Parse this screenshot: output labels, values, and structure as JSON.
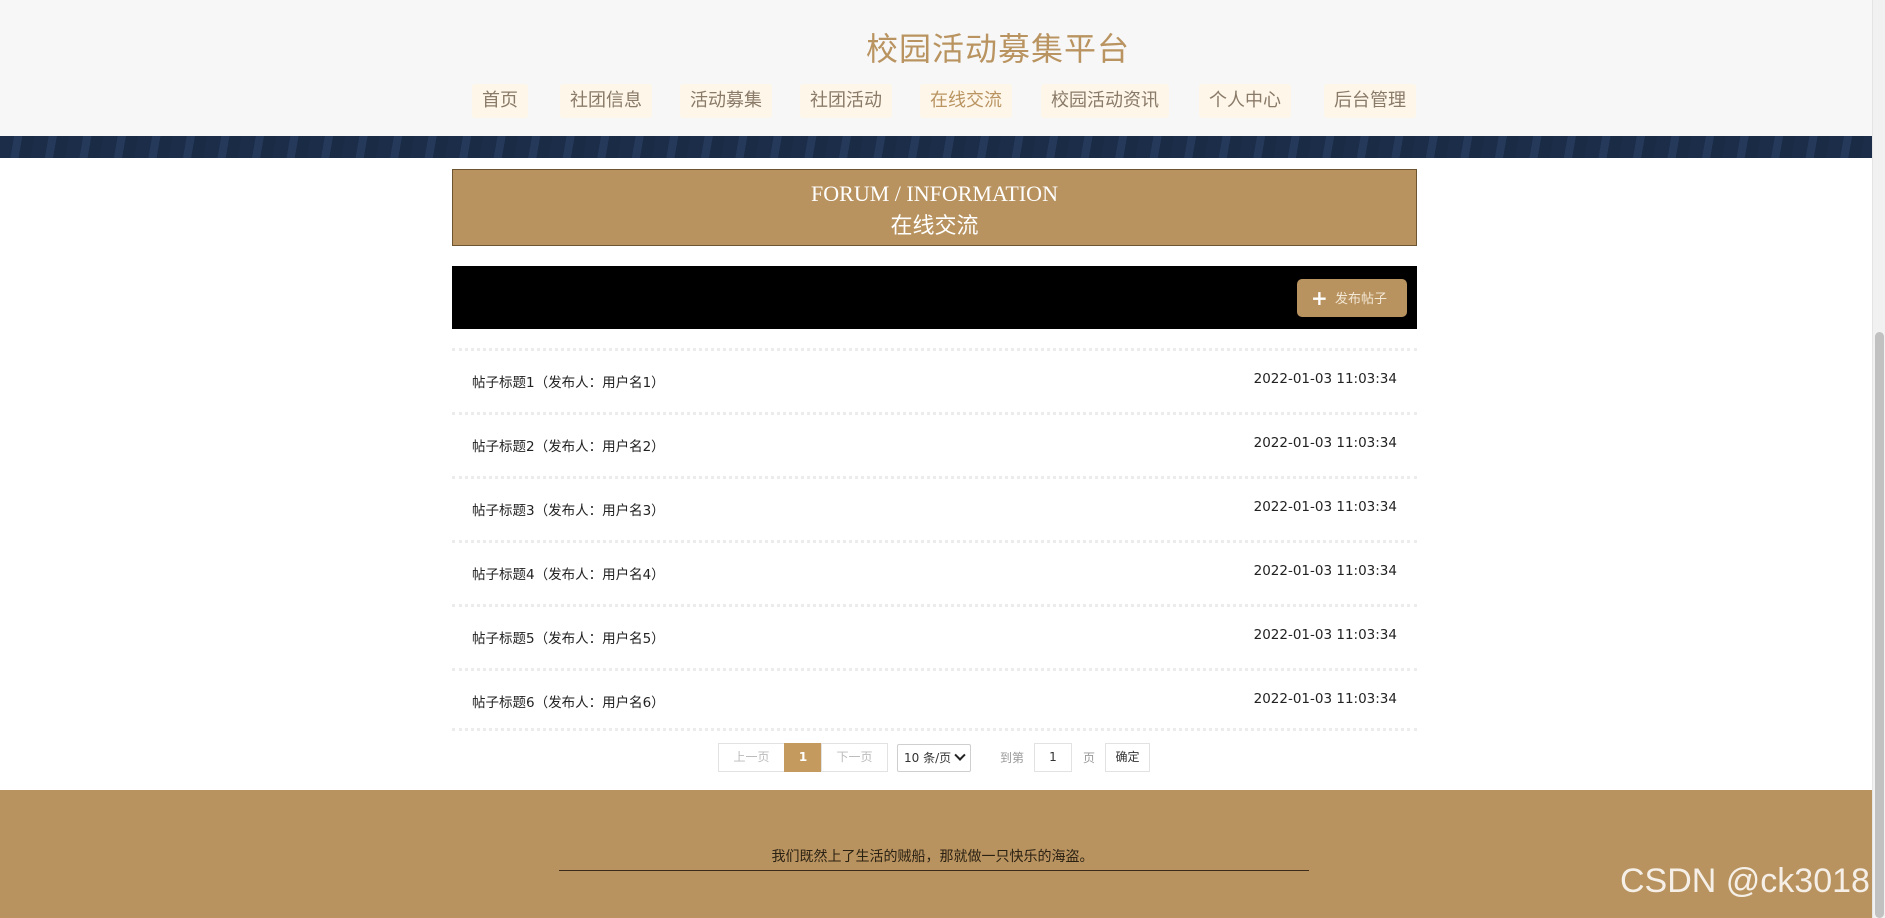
{
  "site": {
    "title": "校园活动募集平台"
  },
  "nav": {
    "items": [
      {
        "label": "首页"
      },
      {
        "label": "社团信息"
      },
      {
        "label": "活动募集"
      },
      {
        "label": "社团活动"
      },
      {
        "label": "在线交流"
      },
      {
        "label": "校园活动资讯"
      },
      {
        "label": "个人中心"
      },
      {
        "label": "后台管理"
      }
    ],
    "active": "在线交流"
  },
  "section": {
    "title_en": "FORUM / INFORMATION",
    "title_cn": "在线交流"
  },
  "toolbar": {
    "post_button_label": "发布帖子",
    "post_button_icon": "plus-icon"
  },
  "posts": [
    {
      "title": "帖子标题1（发布人：用户名1）",
      "time": "2022-01-03 11:03:34"
    },
    {
      "title": "帖子标题2（发布人：用户名2）",
      "time": "2022-01-03 11:03:34"
    },
    {
      "title": "帖子标题3（发布人：用户名3）",
      "time": "2022-01-03 11:03:34"
    },
    {
      "title": "帖子标题4（发布人：用户名4）",
      "time": "2022-01-03 11:03:34"
    },
    {
      "title": "帖子标题5（发布人：用户名5）",
      "time": "2022-01-03 11:03:34"
    },
    {
      "title": "帖子标题6（发布人：用户名6）",
      "time": "2022-01-03 11:03:34"
    }
  ],
  "pagination": {
    "prev": "上一页",
    "current": "1",
    "next": "下一页",
    "page_size": "10 条/页",
    "goto_label": "到第",
    "goto_value": "1",
    "page_unit": "页",
    "confirm": "确定"
  },
  "footer": {
    "text": "我们既然上了生活的贼船，那就做一只快乐的海盗。"
  },
  "watermark": "CSDN @ck3018",
  "colors": {
    "accent": "#b8935f",
    "banner": "#1b2d49",
    "toolbar": "#000000"
  }
}
